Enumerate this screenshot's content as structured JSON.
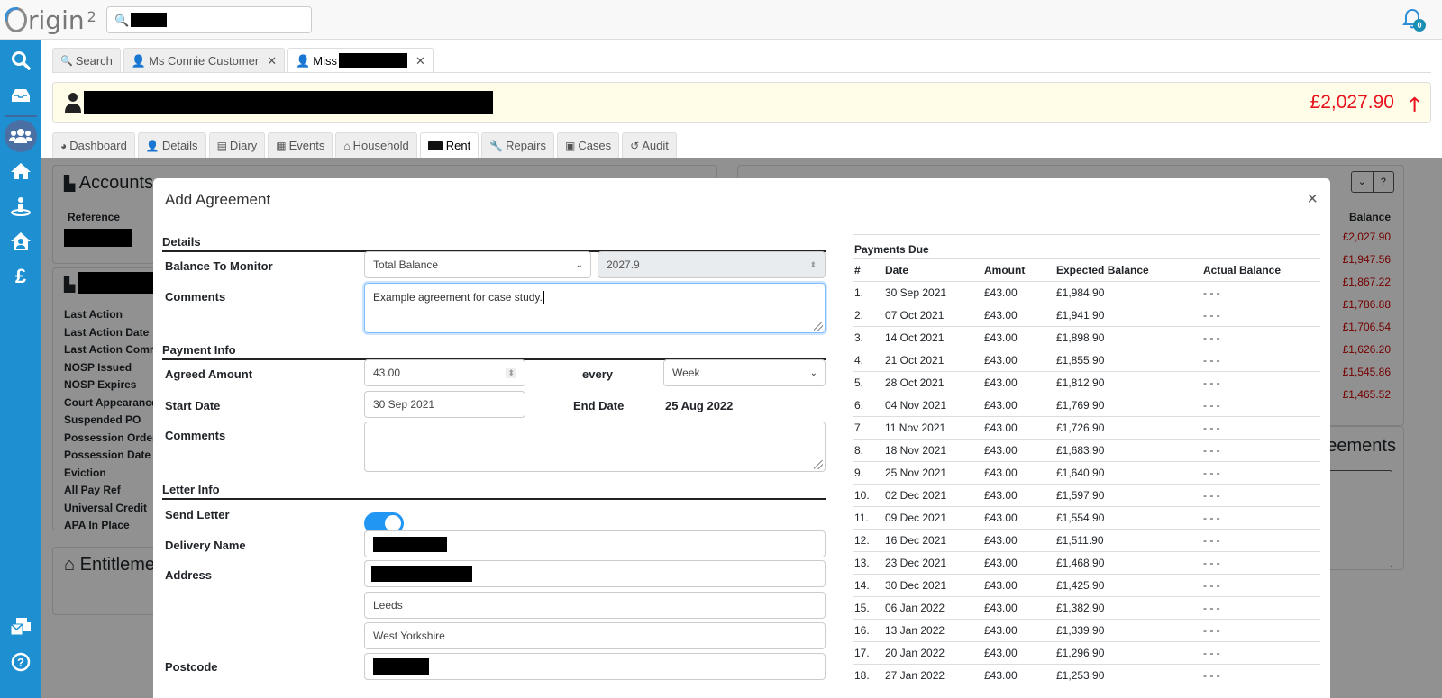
{
  "app": {
    "logo_text": "rigin",
    "logo_superscript": "2",
    "search_value_redacted": true,
    "notifications_count": "0"
  },
  "sidebar": {
    "items": [
      {
        "name": "search",
        "icon": "search-icon"
      },
      {
        "name": "inbox",
        "icon": "inbox-icon"
      },
      {
        "name": "customers",
        "icon": "users-icon",
        "active": true
      },
      {
        "name": "properties",
        "icon": "home-icon"
      },
      {
        "name": "locations",
        "icon": "person-pin-icon"
      },
      {
        "name": "housing",
        "icon": "house-user-icon"
      },
      {
        "name": "finance",
        "icon": "pound-icon"
      },
      {
        "name": "mail",
        "icon": "mail-icon"
      },
      {
        "name": "help",
        "icon": "help-icon"
      }
    ]
  },
  "record_tabs": [
    {
      "label": "Search",
      "icon": "search-icon",
      "closable": false
    },
    {
      "label": "Ms Connie Customer",
      "icon": "user-icon",
      "closable": true
    },
    {
      "label": "Miss",
      "icon": "user-icon",
      "closable": true,
      "active": true,
      "redacted_suffix": true
    }
  ],
  "customer": {
    "balance": "£2,027.90",
    "balance_trend": "up",
    "balance_color": "#e8111c"
  },
  "section_tabs": [
    {
      "label": "Dashboard",
      "icon": "pie-chart-icon"
    },
    {
      "label": "Details",
      "icon": "user-icon"
    },
    {
      "label": "Diary",
      "icon": "book-icon"
    },
    {
      "label": "Events",
      "icon": "calendar-icon"
    },
    {
      "label": "Household",
      "icon": "home-icon"
    },
    {
      "label": "Rent",
      "icon": "money-icon",
      "active": true
    },
    {
      "label": "Repairs",
      "icon": "wrench-icon"
    },
    {
      "label": "Cases",
      "icon": "briefcase-icon"
    },
    {
      "label": "Audit",
      "icon": "history-icon"
    }
  ],
  "background": {
    "accounts_title": "Accounts",
    "reference_header": "Reference",
    "account_fields": [
      "Last Action",
      "Last Action Date",
      "Last Action Comm",
      "NOSP Issued",
      "NOSP Expires",
      "Court Appearance",
      "Suspended PO",
      "Possession Order",
      "Possession Date",
      "Eviction",
      "All Pay Ref",
      "Universal Credit",
      "APA In Place"
    ],
    "entitlements_title": "Entitleme",
    "balance_header": "Balance",
    "balances": [
      "£2,027.90",
      "£1,947.56",
      "£1,867.22",
      "£1,786.88",
      "£1,706.54",
      "£1,626.20",
      "£1,545.86",
      "£1,465.52"
    ],
    "agreements_title": "Agreements"
  },
  "modal": {
    "title": "Add Agreement",
    "close": "×",
    "details_section": "Details",
    "balance_to_monitor_label": "Balance To Monitor",
    "balance_to_monitor_value": "Total Balance",
    "balance_amount_value": "2027.9",
    "comments_label": "Comments",
    "comments_value": "Example agreement for case study.",
    "payment_section": "Payment Info",
    "agreed_amount_label": "Agreed Amount",
    "agreed_amount_value": "43.00",
    "every_label": "every",
    "frequency_value": "Week",
    "start_date_label": "Start Date",
    "start_date_value": "30 Sep 2021",
    "end_date_label": "End Date",
    "end_date_value": "25 Aug 2022",
    "payment_comments_label": "Comments",
    "payment_comments_value": "",
    "letter_section": "Letter Info",
    "send_letter_label": "Send Letter",
    "send_letter_on": true,
    "delivery_name_label": "Delivery Name",
    "address_label": "Address",
    "address_line2": "Leeds",
    "address_line3": "West Yorkshire",
    "postcode_label": "Postcode"
  },
  "payments_due": {
    "caption": "Payments Due",
    "headers": [
      "#",
      "Date",
      "Amount",
      "Expected Balance",
      "Actual Balance"
    ],
    "rows": [
      [
        "1.",
        "30 Sep 2021",
        "£43.00",
        "£1,984.90",
        "- - -"
      ],
      [
        "2.",
        "07 Oct 2021",
        "£43.00",
        "£1,941.90",
        "- - -"
      ],
      [
        "3.",
        "14 Oct 2021",
        "£43.00",
        "£1,898.90",
        "- - -"
      ],
      [
        "4.",
        "21 Oct 2021",
        "£43.00",
        "£1,855.90",
        "- - -"
      ],
      [
        "5.",
        "28 Oct 2021",
        "£43.00",
        "£1,812.90",
        "- - -"
      ],
      [
        "6.",
        "04 Nov 2021",
        "£43.00",
        "£1,769.90",
        "- - -"
      ],
      [
        "7.",
        "11 Nov 2021",
        "£43.00",
        "£1,726.90",
        "- - -"
      ],
      [
        "8.",
        "18 Nov 2021",
        "£43.00",
        "£1,683.90",
        "- - -"
      ],
      [
        "9.",
        "25 Nov 2021",
        "£43.00",
        "£1,640.90",
        "- - -"
      ],
      [
        "10.",
        "02 Dec 2021",
        "£43.00",
        "£1,597.90",
        "- - -"
      ],
      [
        "11.",
        "09 Dec 2021",
        "£43.00",
        "£1,554.90",
        "- - -"
      ],
      [
        "12.",
        "16 Dec 2021",
        "£43.00",
        "£1,511.90",
        "- - -"
      ],
      [
        "13.",
        "23 Dec 2021",
        "£43.00",
        "£1,468.90",
        "- - -"
      ],
      [
        "14.",
        "30 Dec 2021",
        "£43.00",
        "£1,425.90",
        "- - -"
      ],
      [
        "15.",
        "06 Jan 2022",
        "£43.00",
        "£1,382.90",
        "- - -"
      ],
      [
        "16.",
        "13 Jan 2022",
        "£43.00",
        "£1,339.90",
        "- - -"
      ],
      [
        "17.",
        "20 Jan 2022",
        "£43.00",
        "£1,296.90",
        "- - -"
      ],
      [
        "18.",
        "27 Jan 2022",
        "£43.00",
        "£1,253.90",
        "- - -"
      ]
    ]
  }
}
